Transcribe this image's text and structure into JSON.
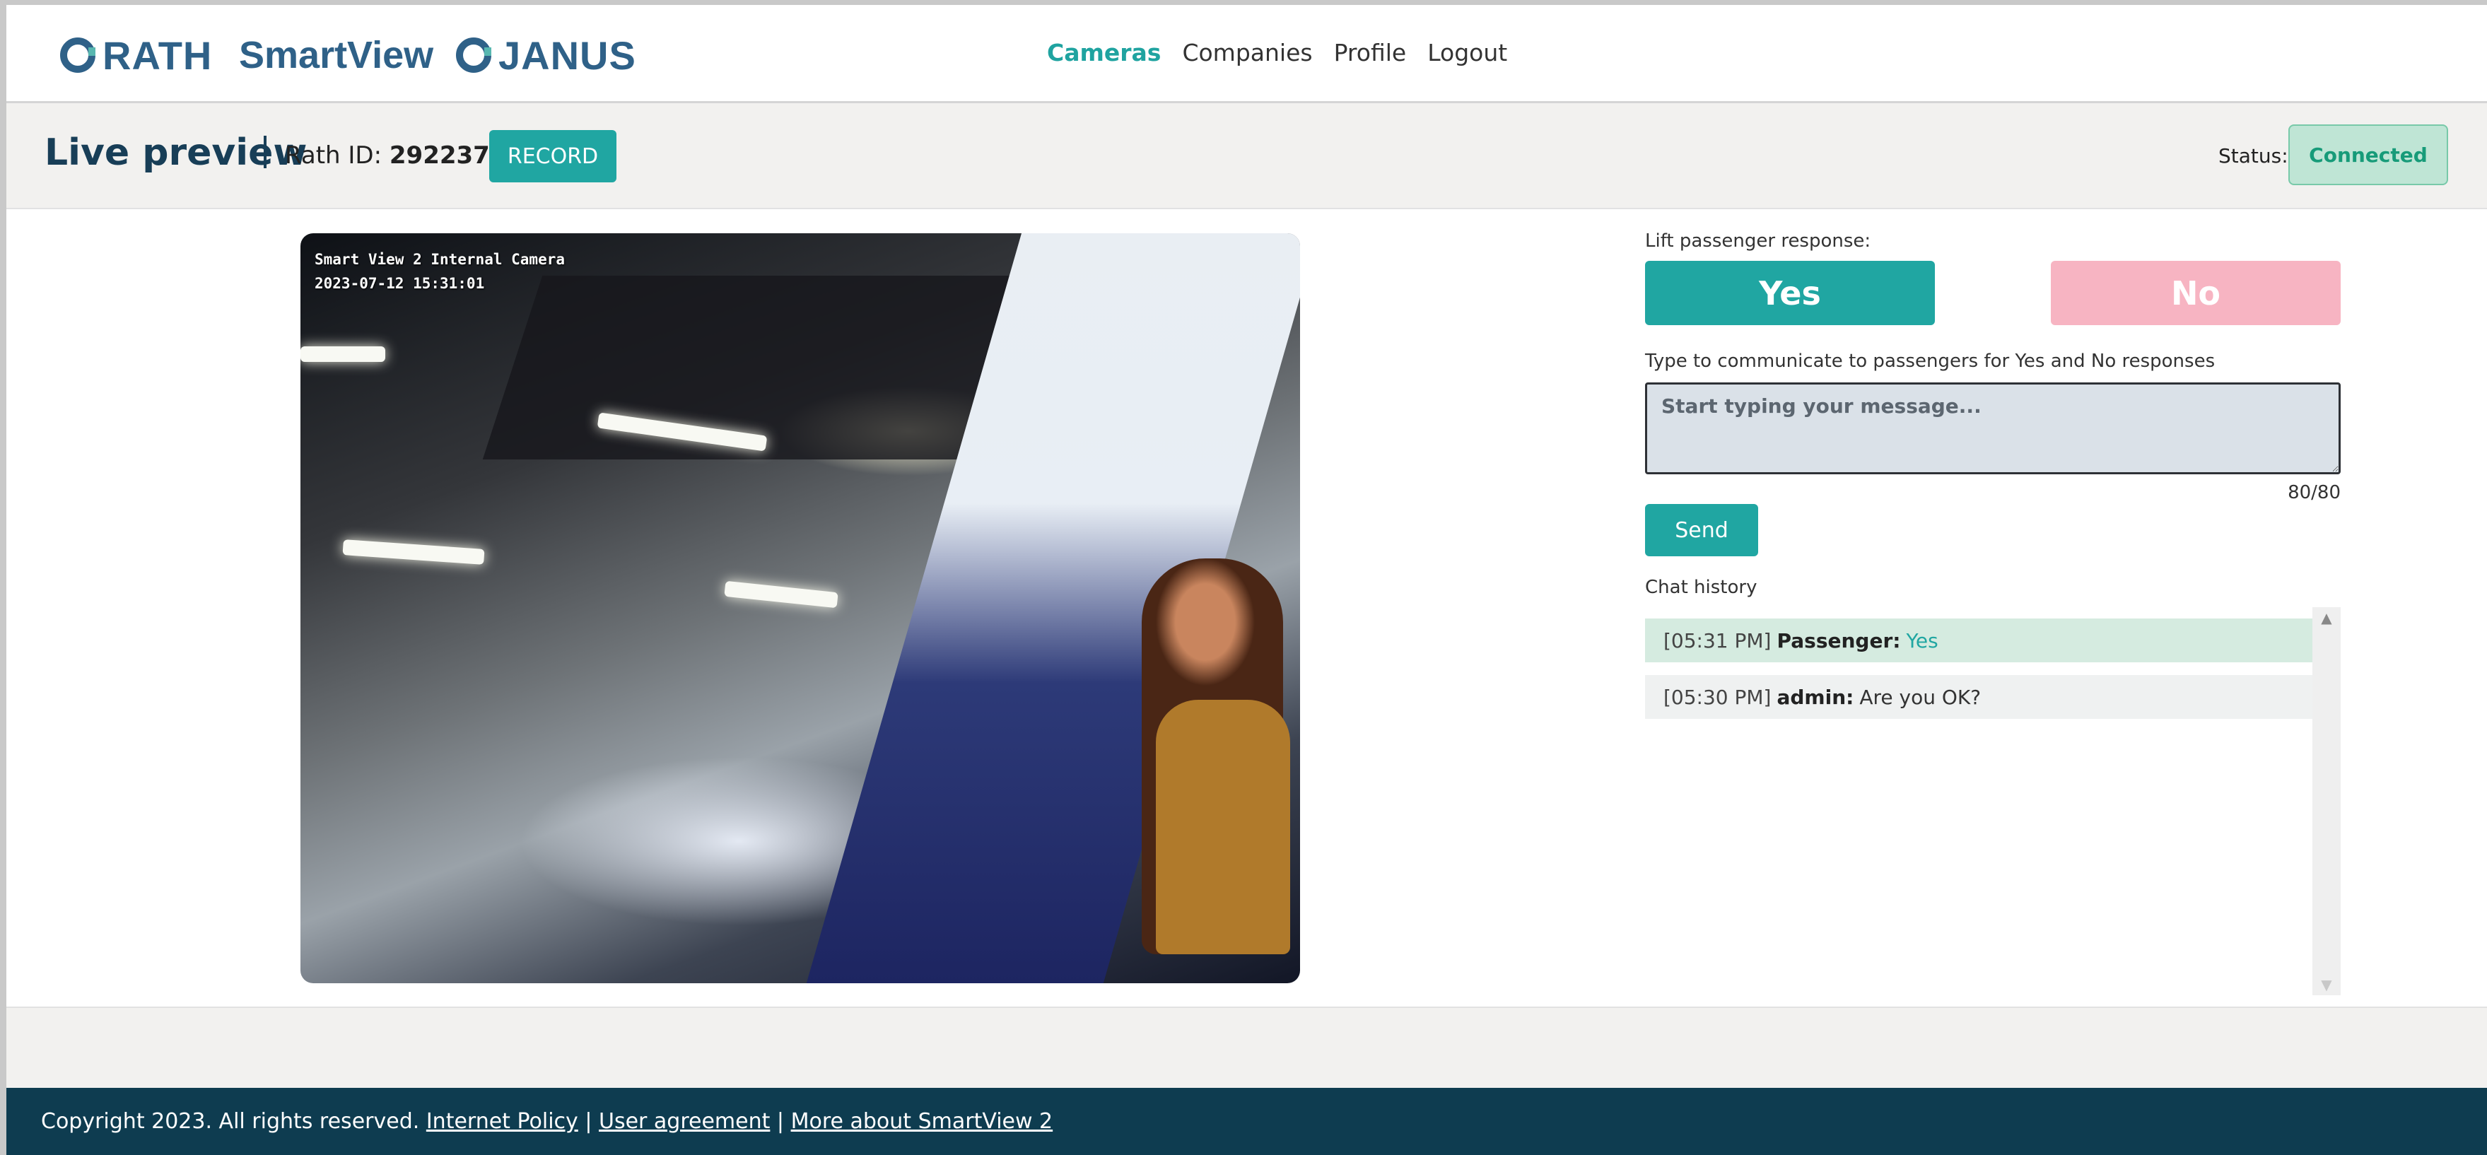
{
  "header": {
    "logos": {
      "rath": "RATH",
      "smartview": "SmartView",
      "janus": "JANUS"
    },
    "nav": [
      {
        "label": "Cameras",
        "active": true
      },
      {
        "label": "Companies",
        "active": false
      },
      {
        "label": "Profile",
        "active": false
      },
      {
        "label": "Logout",
        "active": false
      }
    ]
  },
  "subheader": {
    "title": "Live preview",
    "rath_id_label": "Rath ID:",
    "rath_id_value": "292237",
    "record_label": "RECORD",
    "status_label": "Status:",
    "status_value": "Connected"
  },
  "video": {
    "overlay_line1": "Smart View 2 Internal Camera",
    "overlay_line2": "2023-07-12 15:31:01"
  },
  "response": {
    "label": "Lift passenger response:",
    "yes_label": "Yes",
    "no_label": "No",
    "message_hint": "Type to communicate to passengers for Yes and No responses",
    "message_placeholder": "Start typing your message...",
    "char_count": "80/80",
    "send_label": "Send"
  },
  "chat": {
    "label": "Chat history",
    "messages": [
      {
        "time": "[05:31 PM]",
        "sender": "Passenger:",
        "text": "Yes"
      },
      {
        "time": "[05:30 PM]",
        "sender": "admin:",
        "text": "Are you OK?"
      }
    ]
  },
  "footer": {
    "copyright": "Copyright 2023. All rights reserved.",
    "links": [
      "Internet Policy",
      "User agreement",
      "More about SmartView 2"
    ],
    "separator": "|"
  },
  "colors": {
    "accent": "#20a6a2",
    "brand": "#2f6188",
    "footer_bg": "#0e3c50",
    "no_button": "#f7b4c2",
    "status_bg": "#bfe5d5"
  }
}
